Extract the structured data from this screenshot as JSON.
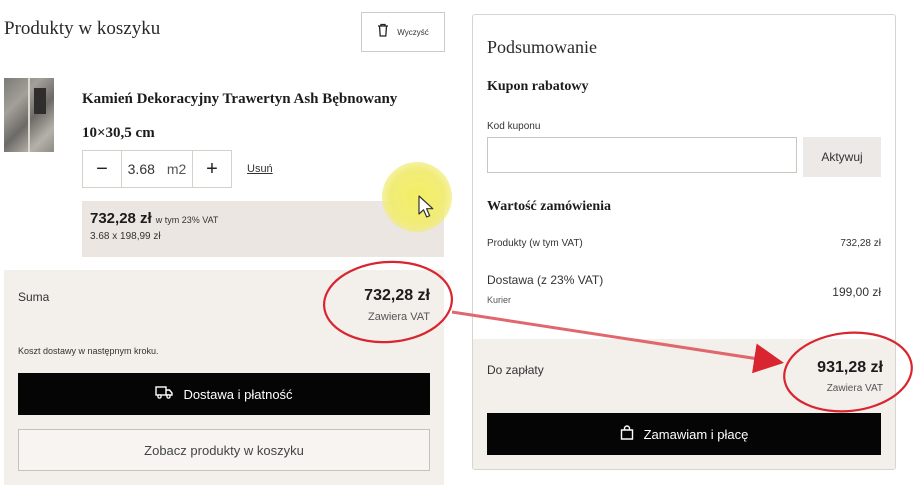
{
  "cart": {
    "title": "Produkty w koszyku",
    "clear_label": "Wyczyść",
    "product": {
      "name": "Kamień Dekoracyjny Trawertyn Ash Bębnowany 10×30,5 cm",
      "quantity": "3.68",
      "unit": "m2",
      "remove_label": "Usuń",
      "price": "732,28 zł",
      "price_vat_note": "w tym 23% VAT",
      "price_calc": "3.68 x 198,99 zł"
    },
    "sum": {
      "label": "Suma",
      "amount": "732,28 zł",
      "vat_note": "Zawiera VAT",
      "delivery_note": "Koszt dostawy w następnym kroku.",
      "checkout_label": "Dostawa i płatność",
      "view_products_label": "Zobacz produkty w koszyku"
    }
  },
  "summary": {
    "title": "Podsumowanie",
    "coupon": {
      "title": "Kupon rabatowy",
      "field_label": "Kod kuponu",
      "value": "",
      "apply_label": "Aktywuj"
    },
    "order": {
      "title": "Wartość zamówienia",
      "products_label": "Produkty (w tym VAT)",
      "products_value": "732,28 zł",
      "shipping_label": "Dostawa (z 23% VAT)",
      "shipping_method": "Kurier",
      "shipping_value": "199,00 zł"
    },
    "pay": {
      "label": "Do zapłaty",
      "amount": "931,28 zł",
      "vat_note": "Zawiera VAT",
      "order_button_label": "Zamawiam i płacę"
    }
  },
  "colors": {
    "panel_bg": "#f3efeb",
    "button_black": "#050505",
    "annotation_red": "#d9252f",
    "cursor_highlight": "#f3ef66"
  },
  "icons": [
    "trash-icon",
    "truck-icon",
    "shopping-bag-icon",
    "cursor-icon"
  ]
}
